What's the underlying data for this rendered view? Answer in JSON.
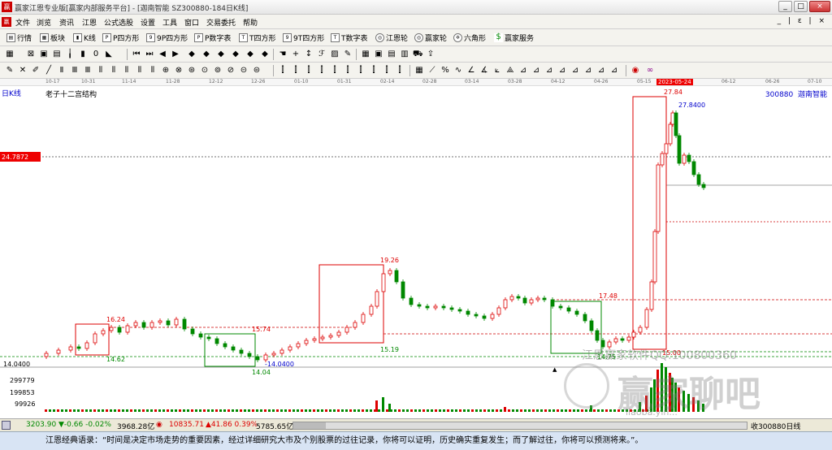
{
  "window": {
    "title": "赢家江恩专业版[赢家内部服务平台] - [迦南智能  SZ300880-184日K线]"
  },
  "menu": [
    "文件",
    "浏览",
    "资讯",
    "江恩",
    "公式选股",
    "设置",
    "工具",
    "窗口",
    "交易委托",
    "帮助"
  ],
  "mdi_controls": "_ | ε | ×",
  "toolbar1": [
    "行情",
    "板块",
    "K线",
    "P四方形",
    "9P四方形",
    "P数字表",
    "T四方形",
    "9T四方形",
    "T数字表",
    "江恩轮",
    "赢家轮",
    "六角形",
    "赢家服务"
  ],
  "chart": {
    "period_label": "日K线",
    "indicator_name": "老子十二宫结构",
    "code": "300880",
    "name": "迦南智能",
    "highlight_date": "2023-05-24",
    "dates": [
      "10-17",
      "10-31",
      "11-14",
      "11-28",
      "12-12",
      "12-26",
      "01-10",
      "01-31",
      "02-14",
      "02-28",
      "03-14",
      "03-28",
      "04-12",
      "04-26",
      "05-15",
      "06-12",
      "06-26",
      "07-10"
    ],
    "price_labels": {
      "p2784": "27.84",
      "p278400": "27.8400",
      "p1926": "19.26",
      "p1748": "17.48",
      "p1624": "16.24",
      "p1574": "15.74",
      "p1519": "15.19",
      "p1462": "14.62",
      "p1404": "14.04",
      "p140400": "-14.0400",
      "p1475": "14.75",
      "p1500": "15.00"
    },
    "left_axis": {
      "marker": "24.7872",
      "low": "14.0400",
      "vol1": "299779",
      "vol2": "199853",
      "vol3": "99926"
    }
  },
  "watermark": {
    "qq": "江恩赢家软件QQ:100800360",
    "brand": "赢家聊吧",
    "url": "liaoba.yin..."
  },
  "status": {
    "sh_index": "3203.90",
    "sh_change": "▼-0.66 -0.02%",
    "sh_amount": "3968.28亿",
    "sz_index": "10835.71",
    "sz_change": "▲41.86 0.39%",
    "sz_amount": "5785.65亿",
    "right_text": "收300880日线"
  },
  "quote": "江恩经典语录：“时间是决定市场走势的重要因素，经过详细研究大市及个别股票的过往记录，你将可以证明，历史确实重复发生；而了解过往，你将可以预测将来。”。"
}
